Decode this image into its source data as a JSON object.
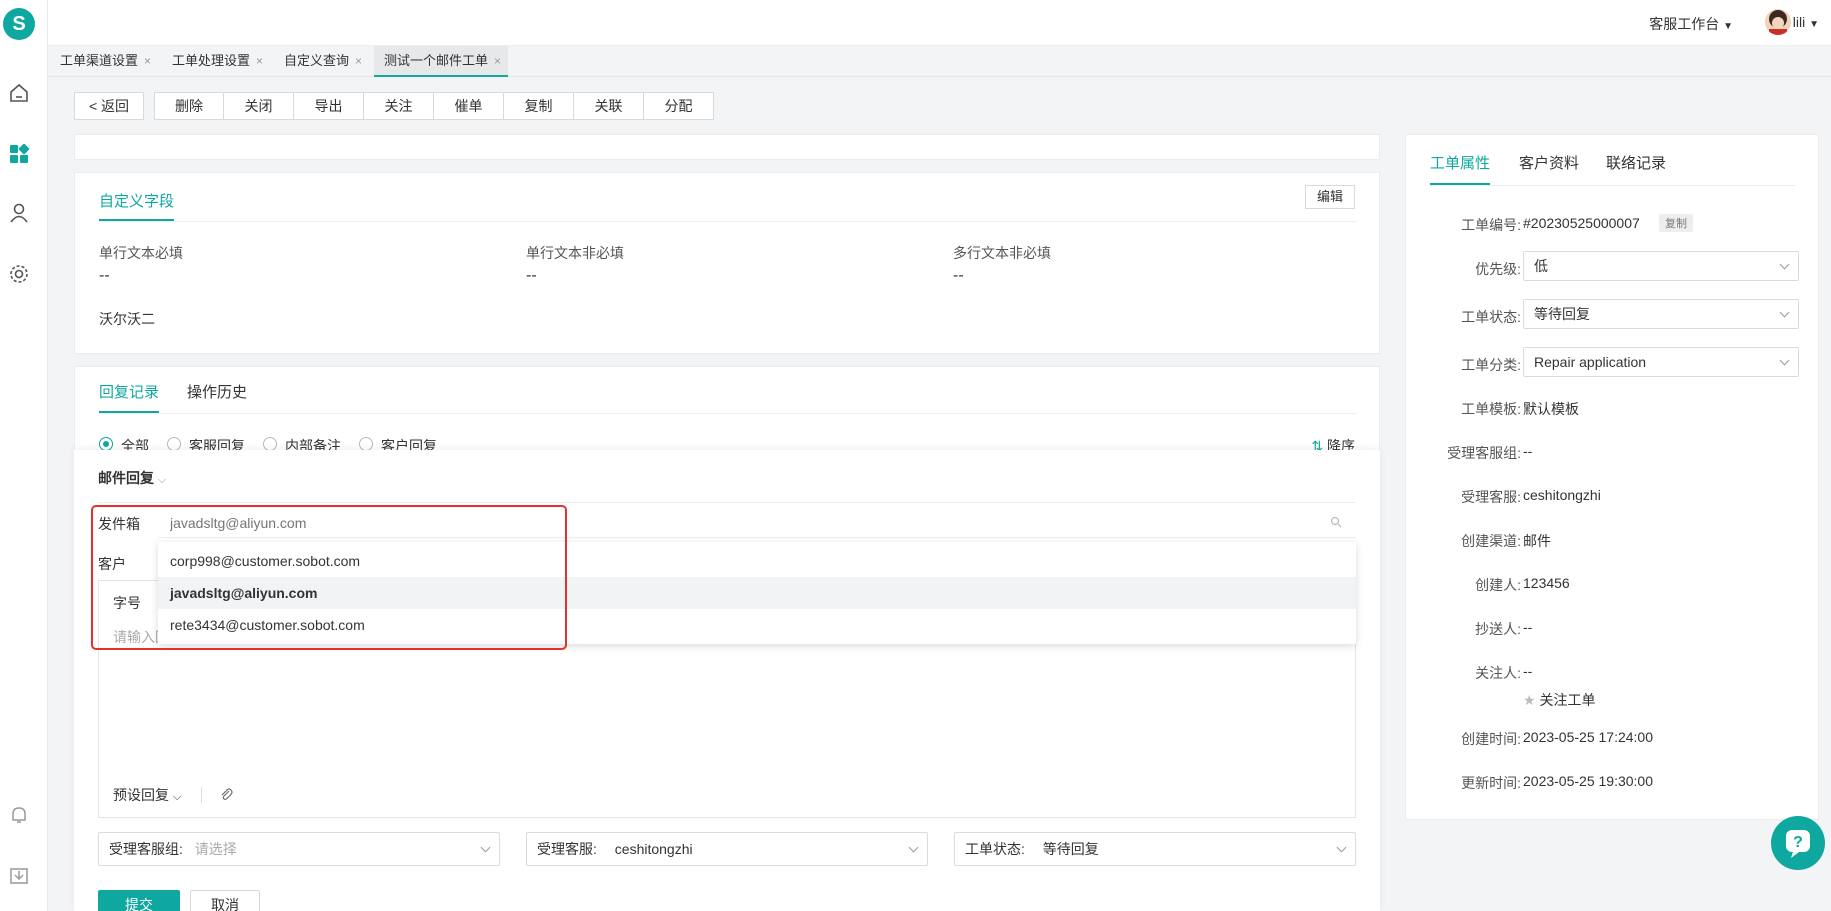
{
  "app": {
    "logo_letter": "S",
    "workbench": "客服工作台",
    "username": "lili"
  },
  "sidebar_icons": [
    "home-icon",
    "dashboard-icon",
    "user-icon",
    "gear-icon",
    "bell-icon",
    "download-icon"
  ],
  "tabs": [
    {
      "label": "工单渠道设置"
    },
    {
      "label": "工单处理设置"
    },
    {
      "label": "自定义查询"
    },
    {
      "label": "测试一个邮件工单"
    }
  ],
  "tab_close": "×",
  "toolbar": {
    "back": "返回",
    "actions": [
      "删除",
      "关闭",
      "导出",
      "关注",
      "催单",
      "复制",
      "关联",
      "分配"
    ]
  },
  "custom_fields": {
    "tab": "自定义字段",
    "edit": "编辑",
    "fields": [
      {
        "label": "单行文本必填",
        "value": "--"
      },
      {
        "label": "单行文本非必填",
        "value": "--"
      },
      {
        "label": "多行文本非必填",
        "value": "--"
      }
    ],
    "extra_value": "沃尔沃二"
  },
  "records": {
    "tabs": [
      "回复记录",
      "操作历史"
    ],
    "filters": [
      "全部",
      "客服回复",
      "内部备注",
      "客户回复"
    ],
    "sort": "降序"
  },
  "reply": {
    "mode": "邮件回复",
    "sender_label": "发件箱",
    "sender_placeholder": "javadsltg@aliyun.com",
    "customer_label": "客户",
    "font_label": "字号",
    "content_placeholder": "请输入回复内容",
    "preset": "预设回复",
    "dropdown": [
      "corp998@customer.sobot.com",
      "javadsltg@aliyun.com",
      "rete3434@customer.sobot.com"
    ],
    "group_label": "受理客服组:",
    "group_placeholder": "请选择",
    "agent_label": "受理客服:",
    "agent_value": "ceshitongzhi",
    "status_label": "工单状态:",
    "status_value": "等待回复",
    "submit": "提交",
    "cancel": "取消"
  },
  "right_panel": {
    "tabs": [
      "工单属性",
      "客户资料",
      "联络记录"
    ],
    "ticket_no_label": "工单编号:",
    "ticket_no": "#20230525000007",
    "copy": "复制",
    "priority_label": "优先级:",
    "priority": "低",
    "status_label": "工单状态:",
    "status": "等待回复",
    "category_label": "工单分类:",
    "category": "Repair application",
    "template_label": "工单模板:",
    "template": "默认模板",
    "group_label": "受理客服组:",
    "group": "--",
    "agent_label": "受理客服:",
    "agent": "ceshitongzhi",
    "channel_label": "创建渠道:",
    "channel": "邮件",
    "creator_label": "创建人:",
    "creator": "123456",
    "cc_label": "抄送人:",
    "cc": "--",
    "follower_label": "关注人:",
    "follower": "--",
    "follow_btn": "关注工单",
    "created_label": "创建时间:",
    "created": "2023-05-25 17:24:00",
    "updated_label": "更新时间:",
    "updated": "2023-05-25 19:30:00"
  },
  "colors": {
    "accent": "#0fa8a0",
    "highlight": "#e0332c"
  }
}
